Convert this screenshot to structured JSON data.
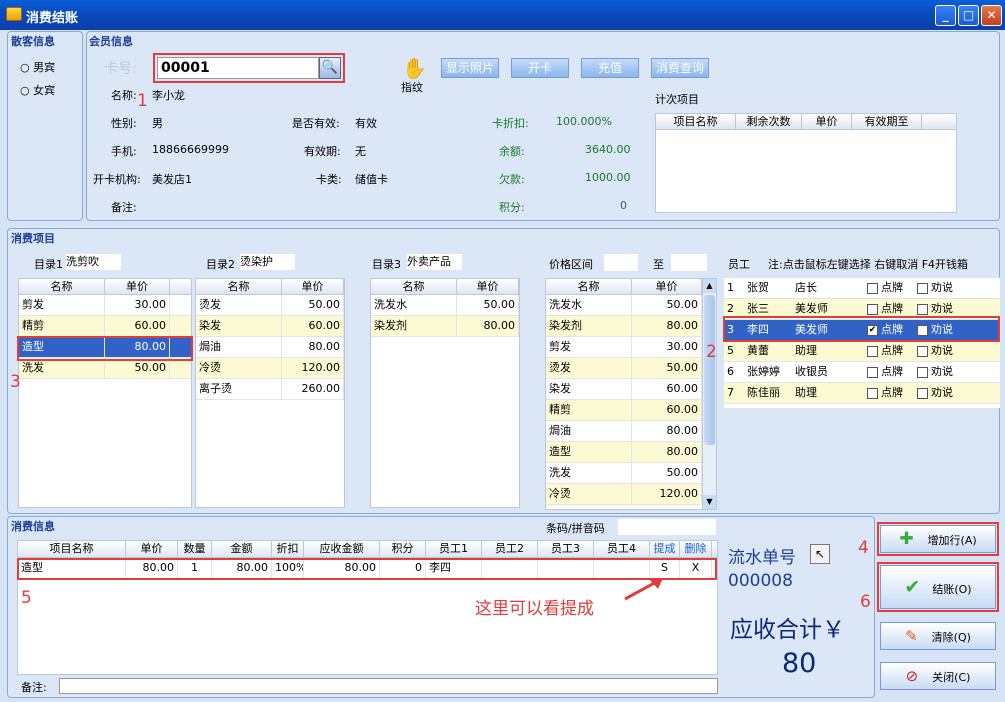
{
  "window": {
    "title": "消费结账"
  },
  "guest": {
    "title": "散客信息",
    "male": "男宾",
    "female": "女宾"
  },
  "member": {
    "title": "会员信息",
    "card_label": "卡号:",
    "card_value": "00001",
    "name_label": "名称:",
    "name": "李小龙",
    "gender_label": "性别:",
    "gender": "男",
    "valid_label": "是否有效:",
    "valid": "有效",
    "phone_label": "手机:",
    "phone": "18866669999",
    "expiry_label": "有效期:",
    "expiry": "无",
    "branch_label": "开卡机构:",
    "branch": "美发店1",
    "cardtype_label": "卡类:",
    "cardtype": "储值卡",
    "remark_label": "备注:",
    "discount_label": "卡折扣:",
    "discount": "100.000%",
    "balance_label": "余额:",
    "balance": "3640.00",
    "debt_label": "欠款:",
    "debt": "1000.00",
    "points_label": "积分:",
    "points": "0",
    "fingerprint": "指纹",
    "btn_photo": "显示照片",
    "btn_open": "开卡",
    "btn_recharge": "充值",
    "btn_query": "消费查询",
    "count_items_title": "计次项目",
    "count_cols": [
      "项目名称",
      "剩余次数",
      "单价",
      "有效期至"
    ]
  },
  "consume": {
    "title": "消费项目",
    "cat1_label": "目录1",
    "cat1": "洗剪吹",
    "cat2_label": "目录2",
    "cat2": "烫染护",
    "cat3_label": "目录3",
    "cat3": "外卖产品",
    "price_range_label": "价格区间",
    "to_label": "至",
    "col_name": "名称",
    "col_price": "单价",
    "list1": [
      [
        "剪发",
        "30.00"
      ],
      [
        "精剪",
        "60.00"
      ],
      [
        "造型",
        "80.00"
      ],
      [
        "洗发",
        "50.00"
      ]
    ],
    "list2": [
      [
        "烫发",
        "50.00"
      ],
      [
        "染发",
        "60.00"
      ],
      [
        "焗油",
        "80.00"
      ],
      [
        "冷烫",
        "120.00"
      ],
      [
        "离子烫",
        "260.00"
      ]
    ],
    "list3": [
      [
        "洗发水",
        "50.00"
      ],
      [
        "染发剂",
        "80.00"
      ]
    ],
    "list4": [
      [
        "洗发水",
        "50.00"
      ],
      [
        "染发剂",
        "80.00"
      ],
      [
        "剪发",
        "30.00"
      ],
      [
        "烫发",
        "50.00"
      ],
      [
        "染发",
        "60.00"
      ],
      [
        "精剪",
        "60.00"
      ],
      [
        "焗油",
        "80.00"
      ],
      [
        "造型",
        "80.00"
      ],
      [
        "洗发",
        "50.00"
      ],
      [
        "冷烫",
        "120.00"
      ]
    ],
    "staff_label": "员工",
    "staff_note": "注:点击鼠标左键选择 右键取消 F4开钱箱",
    "staff": [
      [
        "1",
        "张贺",
        "店长",
        "",
        ""
      ],
      [
        "2",
        "张三",
        "美发师",
        "",
        ""
      ],
      [
        "3",
        "李四",
        "美发师",
        "✔",
        ""
      ],
      [
        "5",
        "黄蕾",
        "助理",
        "",
        ""
      ],
      [
        "6",
        "张婷婷",
        "收银员",
        "",
        ""
      ],
      [
        "7",
        "陈佳丽",
        "助理",
        "",
        ""
      ]
    ],
    "point_card": "点牌",
    "persuade": "劝说"
  },
  "bill": {
    "title": "消费信息",
    "barcode_label": "条码/拼音码",
    "cols": [
      "项目名称",
      "单价",
      "数量",
      "金额",
      "折扣",
      "应收金额",
      "积分",
      "员工1",
      "员工2",
      "员工3",
      "员工4",
      "提成",
      "删除"
    ],
    "row": [
      "造型",
      "80.00",
      "1",
      "80.00",
      "100%",
      "80.00",
      "0",
      "李四",
      "",
      "",
      "",
      "S",
      "X"
    ],
    "annotation": "这里可以看提成",
    "serial_label": "流水单号",
    "serial": "000008",
    "total_label": "应收合计￥",
    "total": "80",
    "remark_label": "备注:"
  },
  "actions": {
    "add_row": "增加行(A)",
    "checkout": "结账(O)",
    "clear": "清除(Q)",
    "close": "关闭(C)"
  },
  "markers": [
    "1",
    "2",
    "3",
    "4",
    "5",
    "6"
  ]
}
